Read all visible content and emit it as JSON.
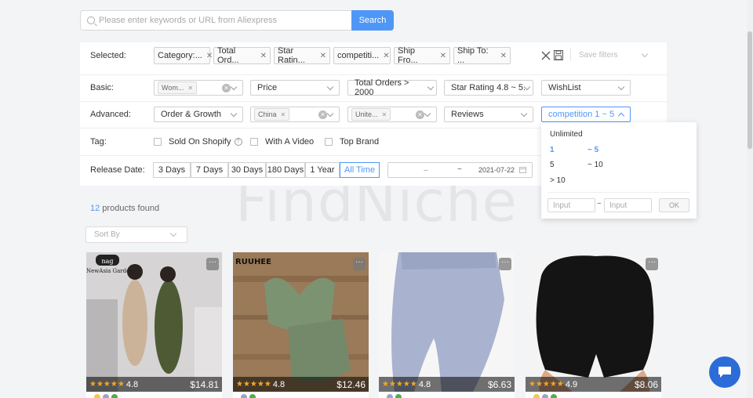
{
  "search": {
    "placeholder": "Please enter keywords or URL from Aliexpress",
    "button": "Search"
  },
  "watermark": "FindNiche",
  "selected": {
    "label": "Selected:",
    "chips": [
      "Category:...",
      "Total Ord...",
      "Star Ratin...",
      "competiti...",
      "Ship Fro...",
      "Ship To: ..."
    ],
    "save_filters": "Save filters"
  },
  "basic": {
    "label": "Basic:",
    "category_tag": "Wom...",
    "price": "Price",
    "total_orders": "Total Orders > 2000",
    "star_rating": "Star Rating 4.8 ~ 5.",
    "wishlist": "WishList"
  },
  "advanced": {
    "label": "Advanced:",
    "order_growth": "Order & Growth",
    "ship_from_tag": "China",
    "ship_to_tag": "Unite...",
    "reviews": "Reviews",
    "competition": "competition 1 ~ 5"
  },
  "tag": {
    "label": "Tag:",
    "options": [
      "Sold On Shopify",
      "With A Video",
      "Top Brand"
    ]
  },
  "release": {
    "label": "Release Date:",
    "options": [
      "3 Days",
      "7 Days",
      "30 Days",
      "180 Days",
      "1 Year",
      "All Time"
    ],
    "active": "All Time",
    "date_from": "--",
    "date_sep": "~",
    "date_to": "2021-07-22"
  },
  "competition_dropdown": {
    "unlimited": "Unlimited",
    "opt1_from": "1",
    "opt1_to": "~ 5",
    "opt2_from": "5",
    "opt2_to": "~ 10",
    "opt3": "> 10",
    "input_min": "Input",
    "input_sep": "~",
    "input_max": "Input",
    "ok": "OK"
  },
  "results": {
    "count": "12",
    "suffix": " products found",
    "sort_placeholder": "Sort By"
  },
  "products": [
    {
      "stars": "★★★★★",
      "rating": "4.8",
      "price": "$14.81",
      "brand": "NewAsia Garden"
    },
    {
      "stars": "★★★★★",
      "rating": "4.8",
      "price": "$12.46",
      "brand": "RUUHEE"
    },
    {
      "stars": "★★★★★",
      "rating": "4.8",
      "price": "$6.63"
    },
    {
      "stars": "★★★★★",
      "rating": "4.9",
      "price": "$8.06"
    }
  ],
  "colors": {
    "accent": "#4f97f6",
    "star": "#f5a623",
    "chat": "#2b6cd9"
  }
}
